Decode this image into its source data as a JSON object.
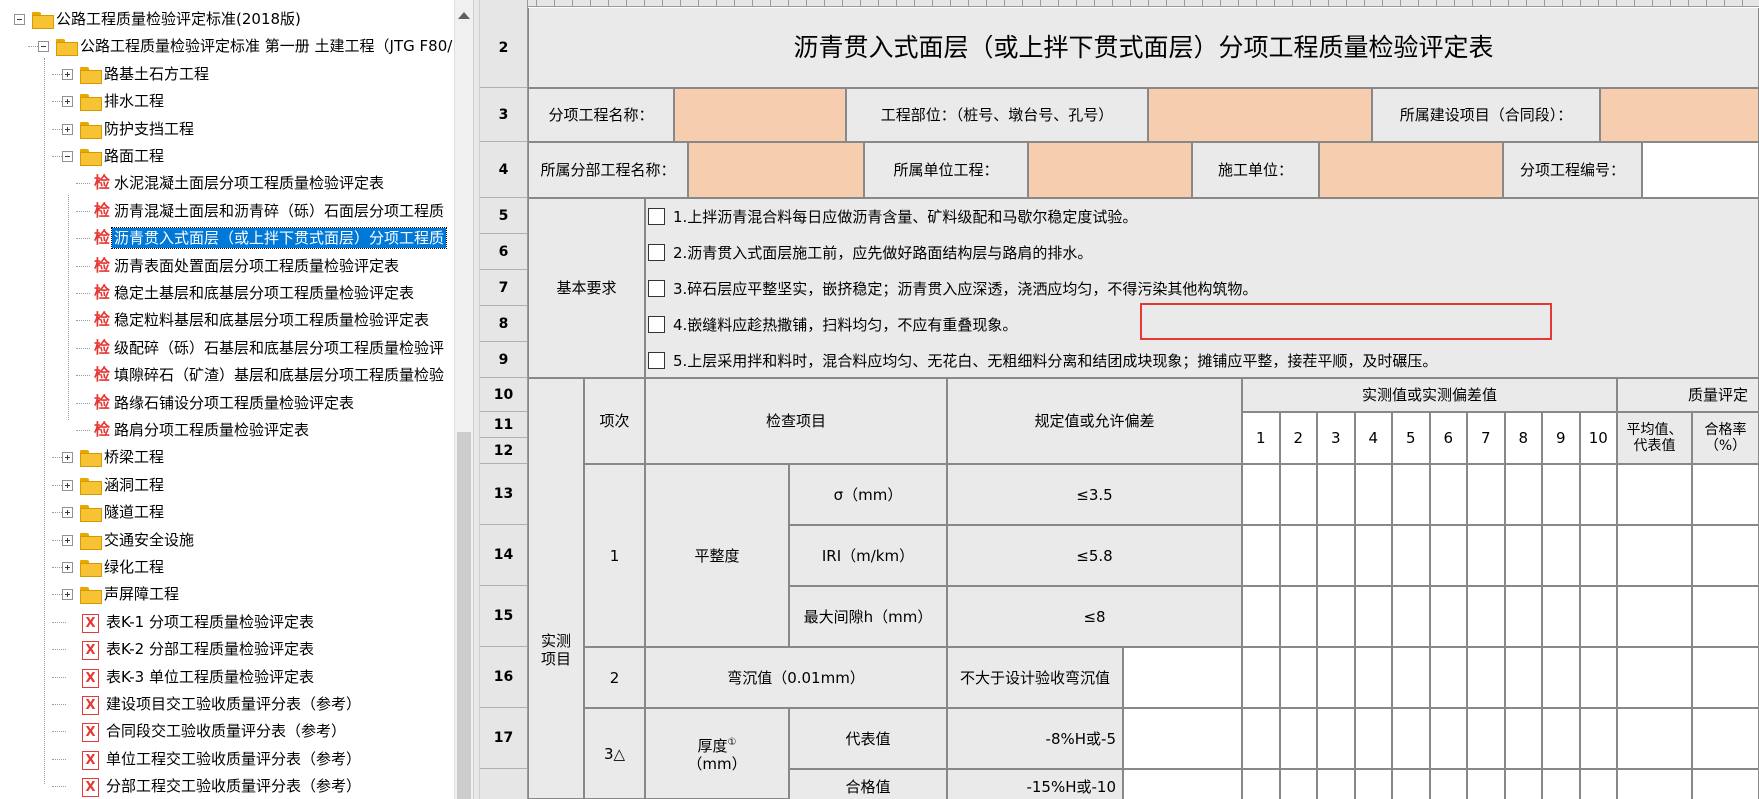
{
  "tree": {
    "items": [
      {
        "label": "公路工程质量检验评定标准(2018版)",
        "type": "folder"
      },
      {
        "label": "公路工程质量检验评定标准 第一册 土建工程（JTG F80/",
        "type": "folder"
      },
      {
        "label": "路基土石方工程",
        "type": "folder"
      },
      {
        "label": "排水工程",
        "type": "folder"
      },
      {
        "label": "防护支挡工程",
        "type": "folder"
      },
      {
        "label": "路面工程",
        "type": "folder"
      },
      {
        "label": "水泥混凝土面层分项工程质量检验评定表",
        "type": "jian"
      },
      {
        "label": "沥青混凝土面层和沥青碎（砾）石面层分项工程质",
        "type": "jian"
      },
      {
        "label": "沥青贯入式面层（或上拌下贯式面层）分项工程质",
        "type": "jian",
        "selected": true
      },
      {
        "label": "沥青表面处置面层分项工程质量检验评定表",
        "type": "jian"
      },
      {
        "label": "稳定土基层和底基层分项工程质量检验评定表",
        "type": "jian"
      },
      {
        "label": "稳定粒料基层和底基层分项工程质量检验评定表",
        "type": "jian"
      },
      {
        "label": "级配碎（砾）石基层和底基层分项工程质量检验评",
        "type": "jian"
      },
      {
        "label": "填隙碎石（矿渣）基层和底基层分项工程质量检验",
        "type": "jian"
      },
      {
        "label": "路缘石铺设分项工程质量检验评定表",
        "type": "jian"
      },
      {
        "label": "路肩分项工程质量检验评定表",
        "type": "jian"
      },
      {
        "label": "桥梁工程",
        "type": "folder"
      },
      {
        "label": "涵洞工程",
        "type": "folder"
      },
      {
        "label": "隧道工程",
        "type": "folder"
      },
      {
        "label": "交通安全设施",
        "type": "folder"
      },
      {
        "label": "绿化工程",
        "type": "folder"
      },
      {
        "label": "声屏障工程",
        "type": "folder"
      },
      {
        "label": "表K-1 分项工程质量检验评定表",
        "type": "x"
      },
      {
        "label": "表K-2 分部工程质量检验评定表",
        "type": "x"
      },
      {
        "label": "表K-3 单位工程质量检验评定表",
        "type": "x"
      },
      {
        "label": "建设项目交工验收质量评分表（参考）",
        "type": "x"
      },
      {
        "label": "合同段交工验收质量评分表（参考）",
        "type": "x"
      },
      {
        "label": "单位工程交工验收质量评分表（参考）",
        "type": "x"
      },
      {
        "label": "分部工程交工验收质量评分表（参考）",
        "type": "x"
      }
    ],
    "icons": {
      "jian": "检",
      "x": "X"
    }
  },
  "rows": [
    "2",
    "3",
    "4",
    "5",
    "6",
    "7",
    "8",
    "9",
    "10",
    "11",
    "12",
    "13",
    "14",
    "15",
    "16",
    "17"
  ],
  "sheet": {
    "title": "沥青贯入式面层（或上拌下贯式面层）分项工程质量检验评定表",
    "r3": {
      "a": "分项工程名称：",
      "b": "工程部位：（桩号、墩台号、孔号）",
      "c": "所属建设项目（合同段）："
    },
    "r4": {
      "a": "所属分部工程名称：",
      "b": "所属单位工程：",
      "c": "施工单位：",
      "d": "分项工程编号："
    },
    "basic_label": "基本要求",
    "requirements": [
      "1.上拌沥青混合料每日应做沥青含量、矿料级配和马歇尔稳定度试验。",
      "2.沥青贯入式面层施工前，应先做好路面结构层与路肩的排水。",
      "3.碎石层应平整坚实，嵌挤稳定；沥青贯入应深透，浇洒应均匀，不得污染其他构筑物。",
      "4.嵌缝料应趁热撒铺，扫料均匀，不应有重叠现象。",
      "5.上层采用拌和料时，混合料应均匀、无花白、无粗细料分离和结团成块现象；摊铺应平整，接茬平顺，及时碾压。"
    ],
    "header": {
      "measured_item": "实测项目",
      "seq": "项次",
      "check_item": "检查项目",
      "spec": "规定值或允许偏差",
      "measured_values": "实测值或实测偏差值",
      "cols": [
        "1",
        "2",
        "3",
        "4",
        "5",
        "6",
        "7",
        "8",
        "9",
        "10"
      ],
      "quality": "质量评定",
      "avg": "平均值、代表值",
      "rate": "合格率（%）"
    },
    "items": {
      "i1_no": "1",
      "i1_name": "平整度",
      "i1_sub": [
        "σ（mm）",
        "IRI（m/km）",
        "最大间隙h（mm）"
      ],
      "i1_spec": [
        "≤3.5",
        "≤5.8",
        "≤8"
      ],
      "i2_no": "2",
      "i2_name": "弯沉值（0.01mm）",
      "i2_spec": "不大于设计验收弯沉值",
      "i3_no": "3△",
      "i3_name": "厚度",
      "i3_mark": "①",
      "i3_unit": "（mm）",
      "i3_sub": [
        "代表值",
        "合格值"
      ],
      "i3_spec": [
        "-8%H或-5",
        "-15%H或-10"
      ]
    }
  },
  "colors": {
    "input": "#f7cdb0",
    "header": "#eaeaea",
    "selection": "#0078d7",
    "highlight": "#e53935"
  }
}
